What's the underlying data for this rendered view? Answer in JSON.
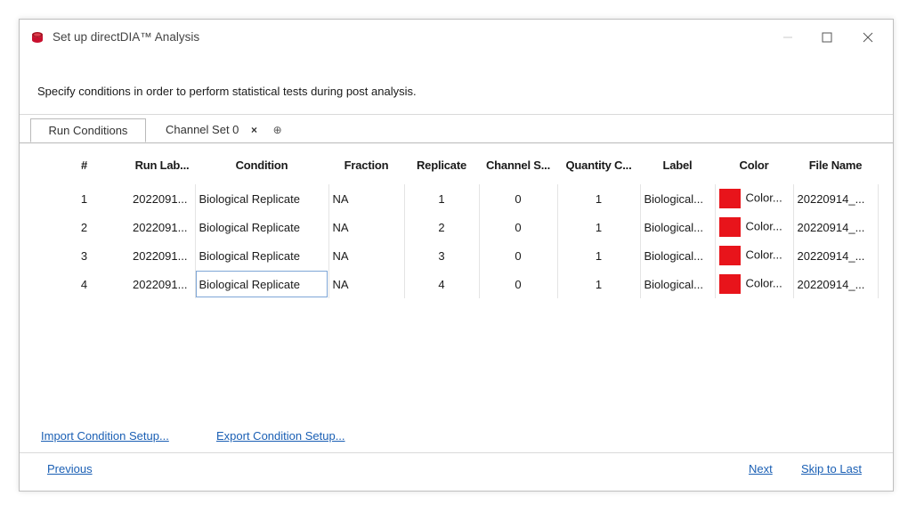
{
  "window": {
    "title": "Set up directDIA™ Analysis",
    "controls": {
      "minimize": "—",
      "maximize": "☐",
      "close": "✕"
    }
  },
  "instructions": "Specify conditions in order to perform statistical tests during post analysis.",
  "tabs": [
    {
      "label": "Run Conditions",
      "active": true
    },
    {
      "label": "Channel Set 0",
      "active": false,
      "close": "×",
      "add": "⊕"
    }
  ],
  "grid": {
    "columns": [
      "#",
      "Run Lab...",
      "Condition",
      "Fraction",
      "Replicate",
      "Channel S...",
      "Quantity C...",
      "Label",
      "Color",
      "File Name"
    ],
    "rows": [
      {
        "num": "1",
        "run_label": "2022091...",
        "condition": "Biological Replicate",
        "fraction": "NA",
        "replicate": "1",
        "channel": "0",
        "quantity": "1",
        "label": "Biological...",
        "color_text": "Color...",
        "file_name": "20220914_..."
      },
      {
        "num": "2",
        "run_label": "2022091...",
        "condition": "Biological Replicate",
        "fraction": "NA",
        "replicate": "2",
        "channel": "0",
        "quantity": "1",
        "label": "Biological...",
        "color_text": "Color...",
        "file_name": "20220914_..."
      },
      {
        "num": "3",
        "run_label": "2022091...",
        "condition": "Biological Replicate",
        "fraction": "NA",
        "replicate": "3",
        "channel": "0",
        "quantity": "1",
        "label": "Biological...",
        "color_text": "Color...",
        "file_name": "20220914_..."
      },
      {
        "num": "4",
        "run_label": "2022091...",
        "condition": "Biological Replicate",
        "fraction": "NA",
        "replicate": "4",
        "channel": "0",
        "quantity": "1",
        "label": "Biological...",
        "color_text": "Color...",
        "file_name": "20220914_..."
      }
    ],
    "selected_row": 4,
    "swatch_color": "#e8141b"
  },
  "links": {
    "import": "Import Condition Setup...",
    "export": "Export Condition Setup..."
  },
  "footer": {
    "previous": "Previous",
    "next": "Next",
    "skip": "Skip to Last"
  },
  "colors": {
    "link": "#1a5fb4",
    "accent_icon": "#c8102e"
  }
}
